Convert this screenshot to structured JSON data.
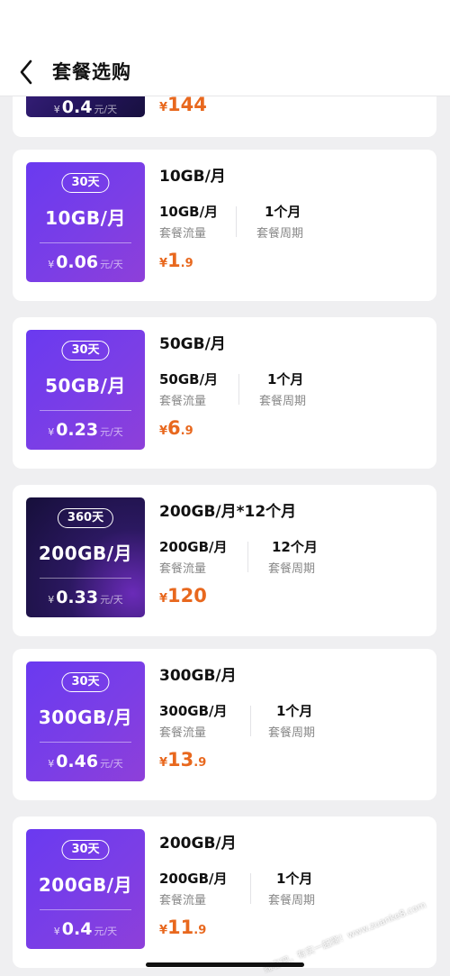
{
  "header": {
    "title": "套餐选购"
  },
  "partial": {
    "badge_price": "0.4",
    "badge_unit": "元/天",
    "price_int": "144",
    "price_dec": ""
  },
  "plans": [
    {
      "days": "30天",
      "gb": "10GB/月",
      "per_day": "0.06",
      "per_day_unit": "元/天",
      "name": "10GB/月",
      "flow": "10GB/月",
      "flow_label": "套餐流量",
      "period": "1个月",
      "period_label": "套餐周期",
      "price_int": "1",
      "price_dec": ".9",
      "dark": false
    },
    {
      "days": "30天",
      "gb": "50GB/月",
      "per_day": "0.23",
      "per_day_unit": "元/天",
      "name": "50GB/月",
      "flow": "50GB/月",
      "flow_label": "套餐流量",
      "period": "1个月",
      "period_label": "套餐周期",
      "price_int": "6",
      "price_dec": ".9",
      "dark": false
    },
    {
      "days": "360天",
      "gb": "200GB/月",
      "per_day": "0.33",
      "per_day_unit": "元/天",
      "name": "200GB/月*12个月",
      "flow": "200GB/月",
      "flow_label": "套餐流量",
      "period": "12个月",
      "period_label": "套餐周期",
      "price_int": "120",
      "price_dec": "",
      "dark": true
    },
    {
      "days": "30天",
      "gb": "300GB/月",
      "per_day": "0.46",
      "per_day_unit": "元/天",
      "name": "300GB/月",
      "flow": "300GB/月",
      "flow_label": "套餐流量",
      "period": "1个月",
      "period_label": "套餐周期",
      "price_int": "13",
      "price_dec": ".9",
      "dark": false
    },
    {
      "days": "30天",
      "gb": "200GB/月",
      "per_day": "0.4",
      "per_day_unit": "元/天",
      "name": "200GB/月",
      "flow": "200GB/月",
      "flow_label": "套餐流量",
      "period": "1个月",
      "period_label": "套餐周期",
      "price_int": "11",
      "price_dec": ".9",
      "dark": false
    }
  ],
  "currency": "¥",
  "watermark": "赚客吧，有实一起赚！www.zuanke8.com",
  "colors": {
    "accent_price": "#e8681e",
    "badge_purple": "#6a3af0",
    "badge_dark": "#160f3a"
  }
}
